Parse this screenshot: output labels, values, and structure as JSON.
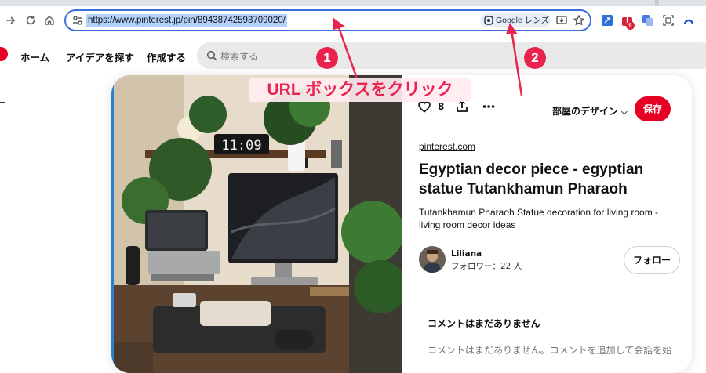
{
  "browser": {
    "url": "https://www.pinterest.jp/pin/89438742593709020/",
    "lens_chip_label": "Google レンズ",
    "ext_badge_count": "6",
    "icons": [
      "forward-icon",
      "reload-icon",
      "home-icon",
      "tune-icon",
      "lens-icon",
      "install-app-icon",
      "bookmark-star-icon"
    ]
  },
  "header": {
    "nav": [
      "ホーム",
      "アイデアを探す",
      "作成する"
    ],
    "search_placeholder": "検索する"
  },
  "pin": {
    "likes": "8",
    "board": "部屋のデザイン",
    "save_label": "保存",
    "source": "pinterest.com",
    "title": "Egyptian decor piece - egyptian statue Tutankhamun Pharaoh",
    "description": "Tutankhamun Pharaoh Statue decoration for living room - living room decor ideas",
    "clock_text": "11:09",
    "user": {
      "name": "Liliana",
      "followers": "フォロワー：22 人",
      "follow_label": "フォロー"
    },
    "comments": {
      "title": "コメントはまだありません",
      "empty": "コメントはまだありません。コメントを追加して会話を始"
    }
  },
  "annotation": {
    "text": "URL ボックスをクリック",
    "badge1": "1",
    "badge2": "2",
    "color": "#e9224e"
  },
  "colors": {
    "brand": "#e60023",
    "omnibox_border": "#3b6fd8",
    "url_selection": "#b3d2fb"
  }
}
